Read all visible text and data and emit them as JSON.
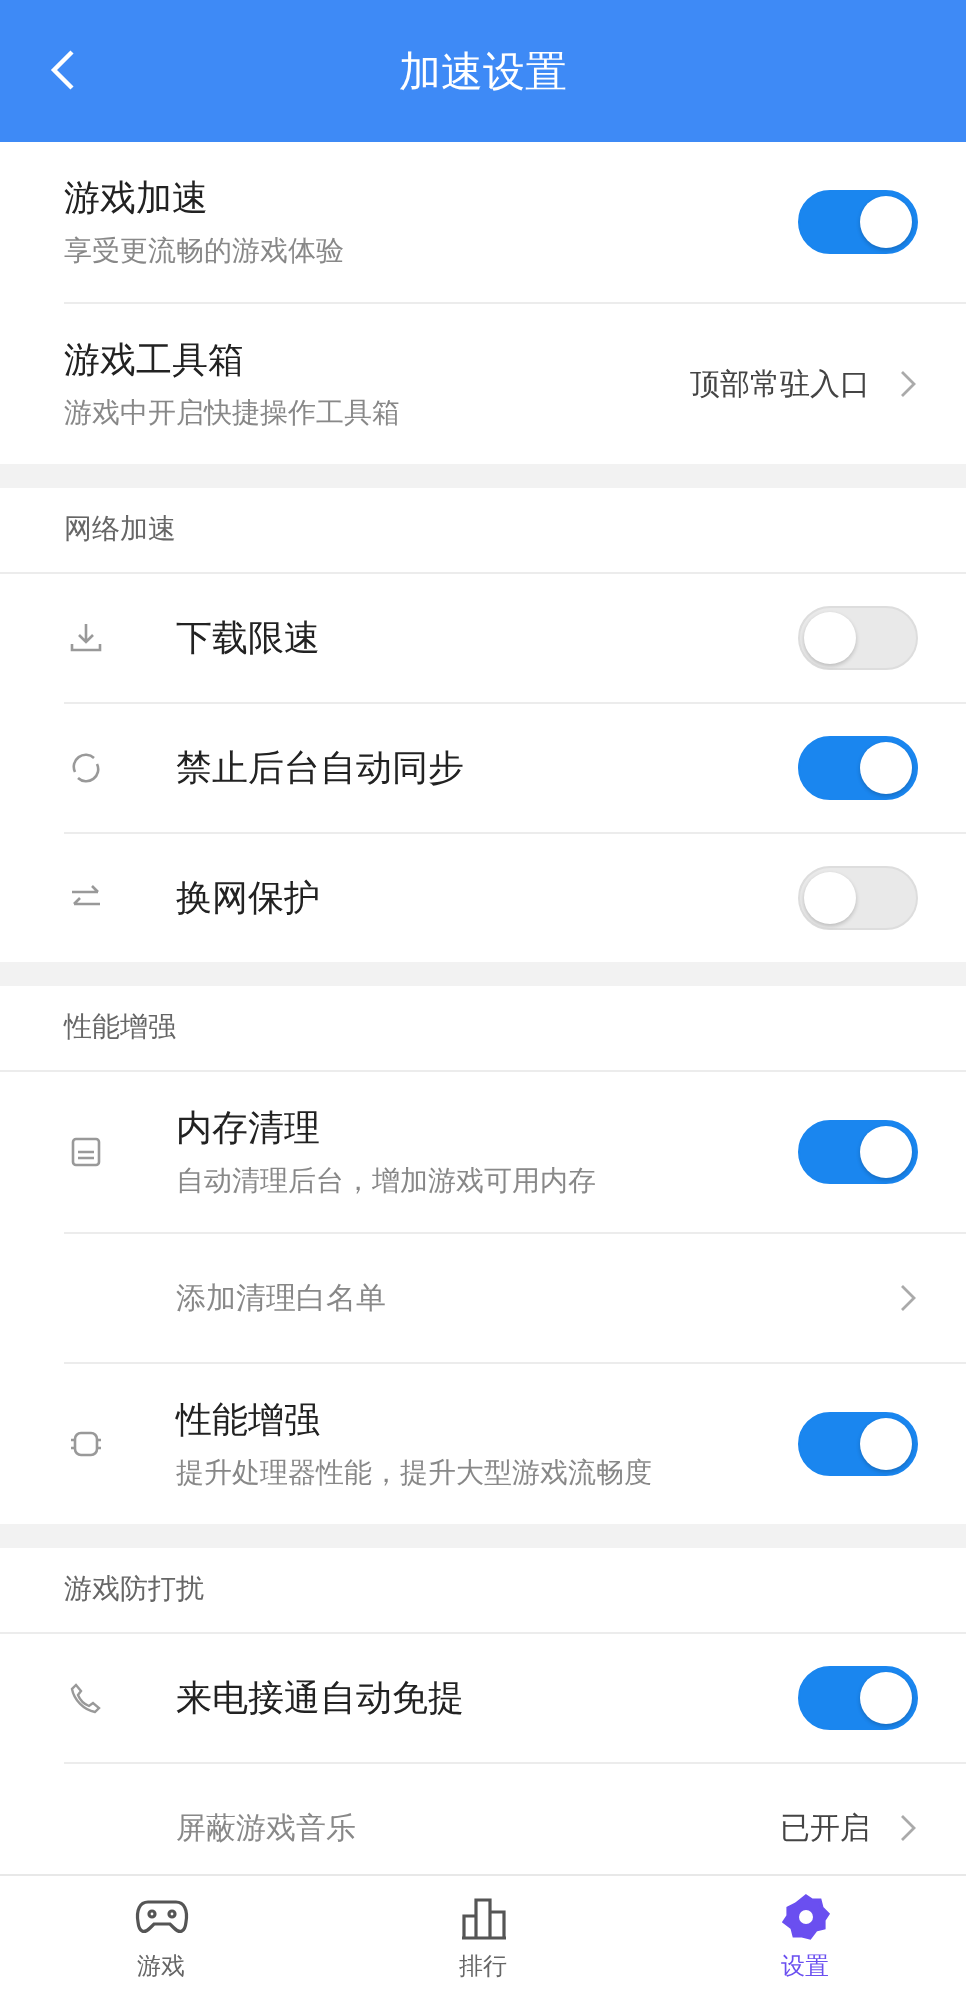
{
  "header": {
    "title": "加速设置"
  },
  "sections": [
    {
      "rows": [
        {
          "kind": "switch",
          "title": "游戏加速",
          "subtitle": "享受更流畅的游戏体验",
          "on": true
        },
        {
          "kind": "link",
          "title": "游戏工具箱",
          "subtitle": "游戏中开启快捷操作工具箱",
          "value": "顶部常驻入口"
        }
      ]
    },
    {
      "heading": "网络加速",
      "rows": [
        {
          "kind": "switch",
          "title": "下载限速",
          "on": false
        },
        {
          "kind": "switch",
          "title": "禁止后台自动同步",
          "on": true
        },
        {
          "kind": "switch",
          "title": "换网保护",
          "on": false
        }
      ]
    },
    {
      "heading": "性能增强",
      "rows": [
        {
          "kind": "switch",
          "title": "内存清理",
          "subtitle": "自动清理后台，增加游戏可用内存",
          "on": true
        },
        {
          "kind": "sublink",
          "title": "添加清理白名单"
        },
        {
          "kind": "switch",
          "title": "性能增强",
          "subtitle": "提升处理器性能，提升大型游戏流畅度",
          "on": true
        }
      ]
    },
    {
      "heading": "游戏防打扰",
      "rows": [
        {
          "kind": "switch",
          "title": "来电接通自动免提",
          "on": true
        },
        {
          "kind": "sublink",
          "title": "屏蔽游戏音乐",
          "value": "已开启"
        }
      ]
    }
  ],
  "nav": [
    {
      "label": "游戏",
      "selected": false
    },
    {
      "label": "排行",
      "selected": false
    },
    {
      "label": "设置",
      "selected": true
    }
  ]
}
